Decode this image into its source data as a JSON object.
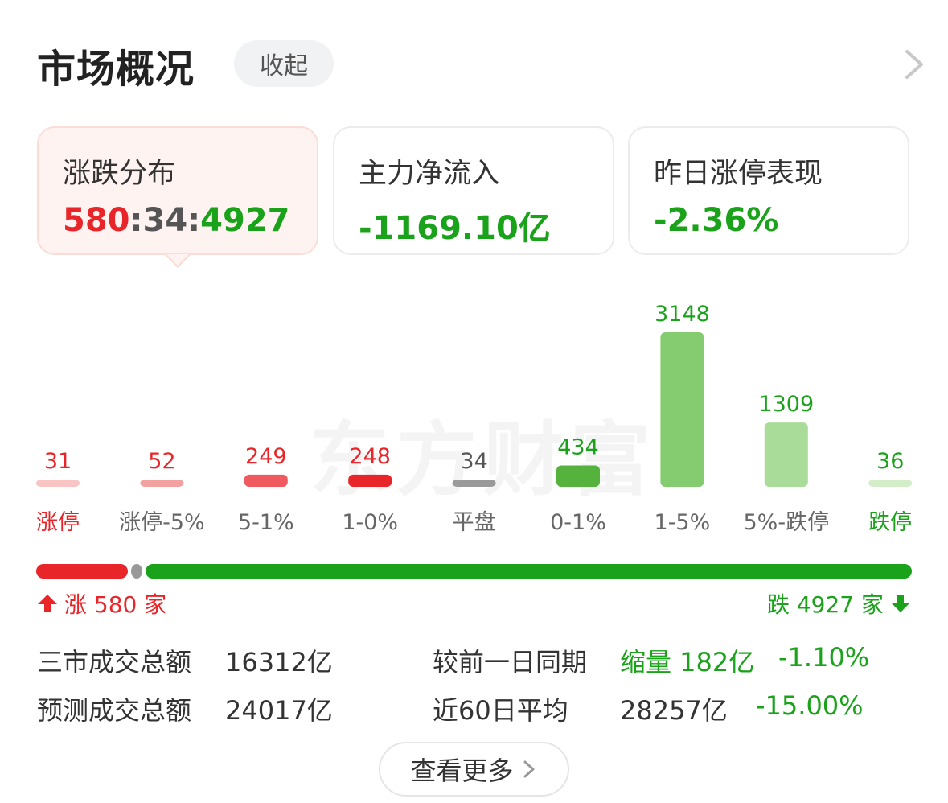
{
  "header": {
    "title": "市场概况",
    "collapse_label": "收起"
  },
  "cards": [
    {
      "title": "涨跌分布",
      "up": "580",
      "flat": "34",
      "down": "4927",
      "sep": ":"
    },
    {
      "title": "主力净流入",
      "value": "-1169.10亿"
    },
    {
      "title": "昨日涨停表现",
      "value": "-2.36%"
    }
  ],
  "watermark": "东方财富",
  "colors": {
    "red": "#e8262a",
    "green": "#1aa31a",
    "gray": "#999999"
  },
  "chart_data": {
    "type": "bar",
    "categories": [
      "涨停",
      "涨停-5%",
      "5-1%",
      "1-0%",
      "平盘",
      "0-1%",
      "1-5%",
      "5%-跌停",
      "跌停"
    ],
    "values": [
      31,
      52,
      249,
      248,
      34,
      434,
      3148,
      1309,
      36
    ],
    "bar_colors": [
      "#f9c4c4",
      "#f3a0a0",
      "#ef5a5f",
      "#e8262a",
      "#9a9a9a",
      "#55b23c",
      "#84cc6f",
      "#a9dc98",
      "#d3edc9"
    ],
    "value_colors": [
      "#e8262a",
      "#e8262a",
      "#e8262a",
      "#e8262a",
      "#555555",
      "#1aa31a",
      "#1aa31a",
      "#1aa31a",
      "#1aa31a"
    ],
    "label_colors": [
      "#e8262a",
      "#666666",
      "#666666",
      "#666666",
      "#666666",
      "#666666",
      "#666666",
      "#666666",
      "#1aa31a"
    ]
  },
  "range": {
    "up_count": 580,
    "flat_count": 34,
    "down_count": 4927,
    "up_label": "涨 580 家",
    "down_label": "跌 4927 家"
  },
  "stats": {
    "total_label": "三市成交总额",
    "total_value": "16312亿",
    "compare_label": "较前一日同期",
    "compare_change": "缩量 182亿",
    "compare_pct": "-1.10%",
    "forecast_label": "预测成交总额",
    "forecast_value": "24017亿",
    "avg_label": "近60日平均",
    "avg_value": "28257亿",
    "avg_pct": "-15.00%"
  },
  "more_label": "查看更多"
}
